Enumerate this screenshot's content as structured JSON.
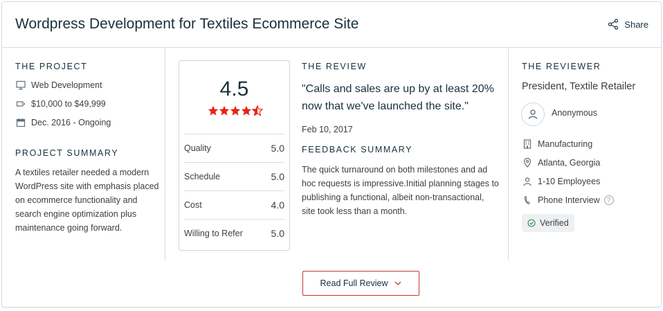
{
  "header": {
    "title": "Wordpress Development for Textiles Ecommerce Site",
    "share_label": "Share"
  },
  "project": {
    "heading": "THE PROJECT",
    "items": [
      {
        "icon": "monitor-icon",
        "label": "Web Development"
      },
      {
        "icon": "tag-icon",
        "label": "$10,000 to $49,999"
      },
      {
        "icon": "calendar-icon",
        "label": "Dec. 2016 - Ongoing"
      }
    ],
    "summary_heading": "PROJECT SUMMARY",
    "summary_text": "A textiles retailer needed a modern WordPress site with emphasis placed on ecommerce functionality and search engine optimization plus maintenance going forward."
  },
  "rating": {
    "score": "4.5",
    "stars": 4.5,
    "rows": [
      {
        "label": "Quality",
        "value": "5.0"
      },
      {
        "label": "Schedule",
        "value": "5.0"
      },
      {
        "label": "Cost",
        "value": "4.0"
      },
      {
        "label": "Willing to Refer",
        "value": "5.0"
      }
    ]
  },
  "review": {
    "heading": "THE REVIEW",
    "quote": "\"Calls and sales are up by at least 20% now that we've launched the site.\"",
    "date": "Feb 10, 2017",
    "feedback_heading": "FEEDBACK SUMMARY",
    "feedback_text": "The quick turnaround on both milestones and ad hoc requests is impressive.Initial planning stages to publishing a functional, albeit non-transactional, site took less than a month."
  },
  "reviewer": {
    "heading": "THE REVIEWER",
    "role": "President, Textile Retailer",
    "name": "Anonymous",
    "items": [
      {
        "icon": "building-icon",
        "label": "Manufacturing"
      },
      {
        "icon": "location-pin-icon",
        "label": "Atlanta, Georgia"
      },
      {
        "icon": "person-icon",
        "label": "1-10 Employees"
      },
      {
        "icon": "phone-icon",
        "label": "Phone Interview"
      }
    ],
    "help_glyph": "?",
    "verified_label": "Verified"
  },
  "footer": {
    "read_full_label": "Read Full Review"
  },
  "colors": {
    "star": "#e62415",
    "button_border": "#cc3333",
    "title": "#17313b",
    "divider": "#d3dde3"
  }
}
